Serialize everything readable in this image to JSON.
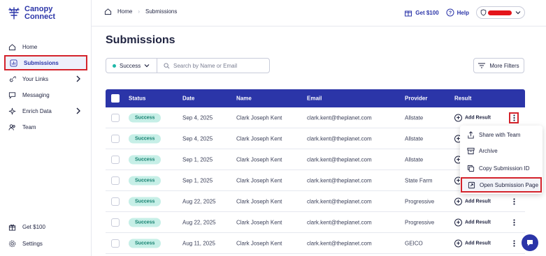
{
  "brand": {
    "line1": "Canopy",
    "line2": "Connect",
    "color": "#2b35a8"
  },
  "sidebar": {
    "items": [
      {
        "label": "Home",
        "icon": "home-icon"
      },
      {
        "label": "Submissions",
        "icon": "chart-icon",
        "active": true
      },
      {
        "label": "Your Links",
        "icon": "link-icon",
        "has_chevron": true
      },
      {
        "label": "Messaging",
        "icon": "chat-icon"
      },
      {
        "label": "Enrich Data",
        "icon": "sparkle-icon",
        "has_chevron": true
      },
      {
        "label": "Team",
        "icon": "team-icon"
      }
    ],
    "bottom": [
      {
        "label": "Get $100",
        "icon": "gift-icon"
      },
      {
        "label": "Settings",
        "icon": "gear-icon"
      }
    ]
  },
  "breadcrumb": {
    "home": "Home",
    "current": "Submissions"
  },
  "top_actions": {
    "get100": "Get $100",
    "help": "Help"
  },
  "page": {
    "title": "Submissions"
  },
  "filters": {
    "status_value": "Success",
    "search_placeholder": "Search by Name or Email",
    "more_filters": "More Filters"
  },
  "table": {
    "columns": [
      "Status",
      "Date",
      "Name",
      "Email",
      "Provider",
      "Result"
    ],
    "rows": [
      {
        "status": "Success",
        "date": "Sep 4, 2025",
        "name": "Clark Joseph Kent",
        "email": "clark.kent@theplanet.com",
        "provider": "Allstate",
        "result": "Add Result"
      },
      {
        "status": "Success",
        "date": "Sep 4, 2025",
        "name": "Clark Joseph Kent",
        "email": "clark.kent@theplanet.com",
        "provider": "Allstate",
        "result": ""
      },
      {
        "status": "Success",
        "date": "Sep 1, 2025",
        "name": "Clark Joseph Kent",
        "email": "clark.kent@theplanet.com",
        "provider": "Allstate",
        "result": ""
      },
      {
        "status": "Success",
        "date": "Sep 1, 2025",
        "name": "Clark Joseph Kent",
        "email": "clark.kent@theplanet.com",
        "provider": "State Farm",
        "result": ""
      },
      {
        "status": "Success",
        "date": "Aug 22, 2025",
        "name": "Clark Joseph Kent",
        "email": "clark.kent@theplanet.com",
        "provider": "Progressive",
        "result": "Add Result"
      },
      {
        "status": "Success",
        "date": "Aug 22, 2025",
        "name": "Clark Joseph Kent",
        "email": "clark.kent@theplanet.com",
        "provider": "Progressive",
        "result": "Add Result"
      },
      {
        "status": "Success",
        "date": "Aug 11, 2025",
        "name": "Clark Joseph Kent",
        "email": "clark.kent@theplanet.com",
        "provider": "GEICO",
        "result": "Add Result"
      }
    ]
  },
  "row_menu": {
    "items": [
      {
        "label": "Share with Team",
        "icon": "share-icon"
      },
      {
        "label": "Archive",
        "icon": "archive-icon"
      },
      {
        "label": "Copy Submission ID",
        "icon": "copy-icon"
      },
      {
        "label": "Open Submission Page",
        "icon": "external-link-icon",
        "highlighted": true
      }
    ]
  },
  "colors": {
    "accent": "#2b35a8",
    "success_bg": "#c6efe7",
    "success_text": "#14806f",
    "highlight": "#d4232b"
  }
}
